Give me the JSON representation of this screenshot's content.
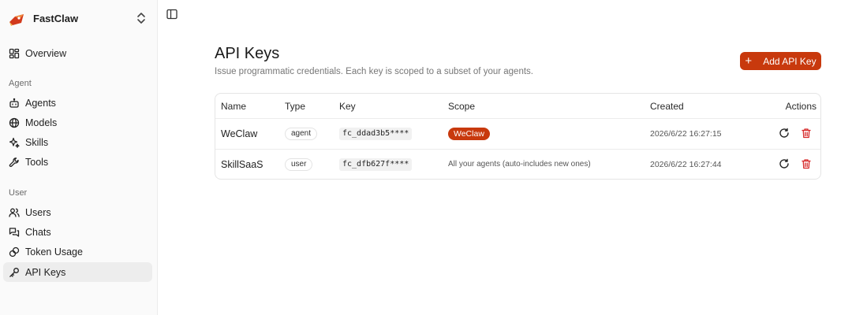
{
  "app": {
    "name": "FastClaw"
  },
  "sidebar": {
    "overview": "Overview",
    "sections": [
      {
        "label": "Agent",
        "items": [
          "Agents",
          "Models",
          "Skills",
          "Tools"
        ]
      },
      {
        "label": "User",
        "items": [
          "Users",
          "Chats",
          "Token Usage",
          "API Keys"
        ]
      }
    ],
    "active": "API Keys"
  },
  "page": {
    "title": "API Keys",
    "subtitle": "Issue programmatic credentials. Each key is scoped to a subset of your agents.",
    "add_button": "Add API Key"
  },
  "table": {
    "headers": {
      "name": "Name",
      "type": "Type",
      "key": "Key",
      "scope": "Scope",
      "created": "Created",
      "actions": "Actions"
    },
    "rows": [
      {
        "name": "WeClaw",
        "type": "agent",
        "key": "fc_ddad3b5****",
        "scope": "WeClaw",
        "created": "2026/6/22 16:27:15"
      },
      {
        "name": "SkillSaaS",
        "type": "user",
        "key": "fc_dfb627f****",
        "scope": "All your agents (auto-includes new ones)",
        "created": "2026/6/22 16:27:44"
      }
    ]
  },
  "colors": {
    "accent": "#c8390d",
    "danger": "#d62828",
    "active_bg": "#ededed"
  },
  "icons": {
    "brand": "fastclaw-logo",
    "switcher": "chevrons-up-down-icon",
    "sidebar_toggle": "panel-left-icon",
    "refresh": "refresh-icon",
    "delete": "trash-icon"
  }
}
